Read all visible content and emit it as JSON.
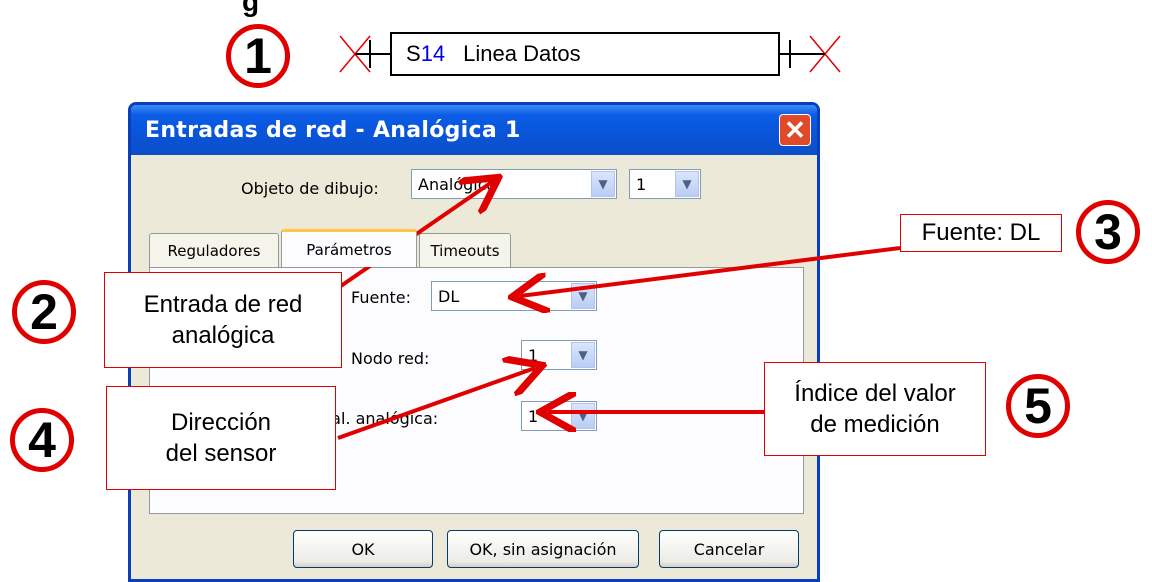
{
  "top_fragment": "g",
  "markers": [
    "1",
    "2",
    "3",
    "4",
    "5"
  ],
  "sensor": {
    "prefix": "S",
    "number": "14",
    "label": "Linea Datos"
  },
  "dialog": {
    "title": "Entradas de red - Analógica 1",
    "close_glyph": "✕",
    "object_label": "Objeto de dibujo:",
    "object_value": "Analógica",
    "object_index": "1",
    "tabs": [
      "Reguladores",
      "Parámetros",
      "Timeouts"
    ],
    "active_tab": "Parámetros",
    "fields": {
      "source_label": "Fuente:",
      "source_value": "DL",
      "node_label": "Nodo red:",
      "node_value": "1",
      "output_label": "Sal. analógica:",
      "output_value": "1"
    },
    "buttons": {
      "ok": "OK",
      "ok_no_assign": "OK, sin asignación",
      "cancel": "Cancelar"
    }
  },
  "callouts": {
    "c2_line1": "Entrada de red",
    "c2_line2": "analógica",
    "c3": "Fuente: DL",
    "c4_line1": "Dirección",
    "c4_line2": "del sensor",
    "c5_line1": "Índice del valor",
    "c5_line2": "de medición"
  },
  "colors": {
    "annotation": "#e00000",
    "title_bar": "#0b5ce6",
    "sensor_number": "#0000ee"
  },
  "icons": {
    "dropdown": "chevron-down-icon",
    "close": "close-icon",
    "pin": "x-mark-icon"
  }
}
